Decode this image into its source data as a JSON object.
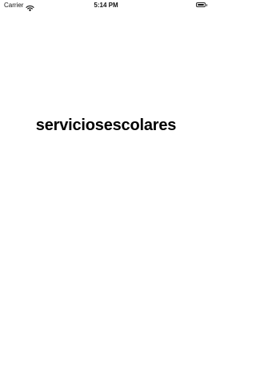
{
  "status_bar": {
    "carrier": "Carrier",
    "time": "5:14 PM",
    "battery_level": 1.0,
    "icons": [
      "wifi-icon",
      "battery-icon"
    ]
  },
  "main": {
    "title": "serviciosescolares"
  },
  "colors": {
    "background": "#ffffff",
    "text": "#000000"
  }
}
